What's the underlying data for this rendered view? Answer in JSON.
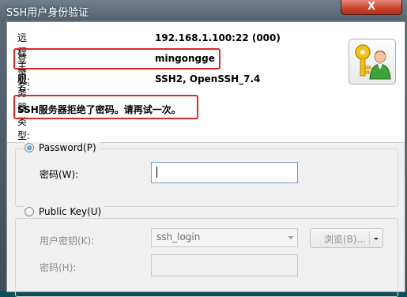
{
  "window": {
    "title": "SSH用户身份验证",
    "close_label": "X"
  },
  "info": {
    "host_label": "远程主机:",
    "host_value": "192.168.1.100:22 (000)",
    "login_label": "登录名:",
    "login_value": "mingongge",
    "server_type_label": "服务器类型:",
    "server_type_value": "SSH2, OpenSSH_7.4",
    "error_message": "SSH服务器拒绝了密码。请再试一次。",
    "icon": "key-user-icon"
  },
  "password_method": {
    "label": "Password(P)",
    "selected": true,
    "password_label": "密码(W):",
    "password_value": ""
  },
  "publickey_method": {
    "label": "Public Key(U)",
    "selected": false,
    "user_key_label": "用户密钥(K):",
    "user_key_value": "ssh_login",
    "browse_label": "浏览(B)...",
    "passphrase_label": "密码(H):",
    "passphrase_value": ""
  },
  "colors": {
    "highlight": "#d9272b",
    "titlebar": "#5f6f7b",
    "close_button": "#c7402a"
  }
}
